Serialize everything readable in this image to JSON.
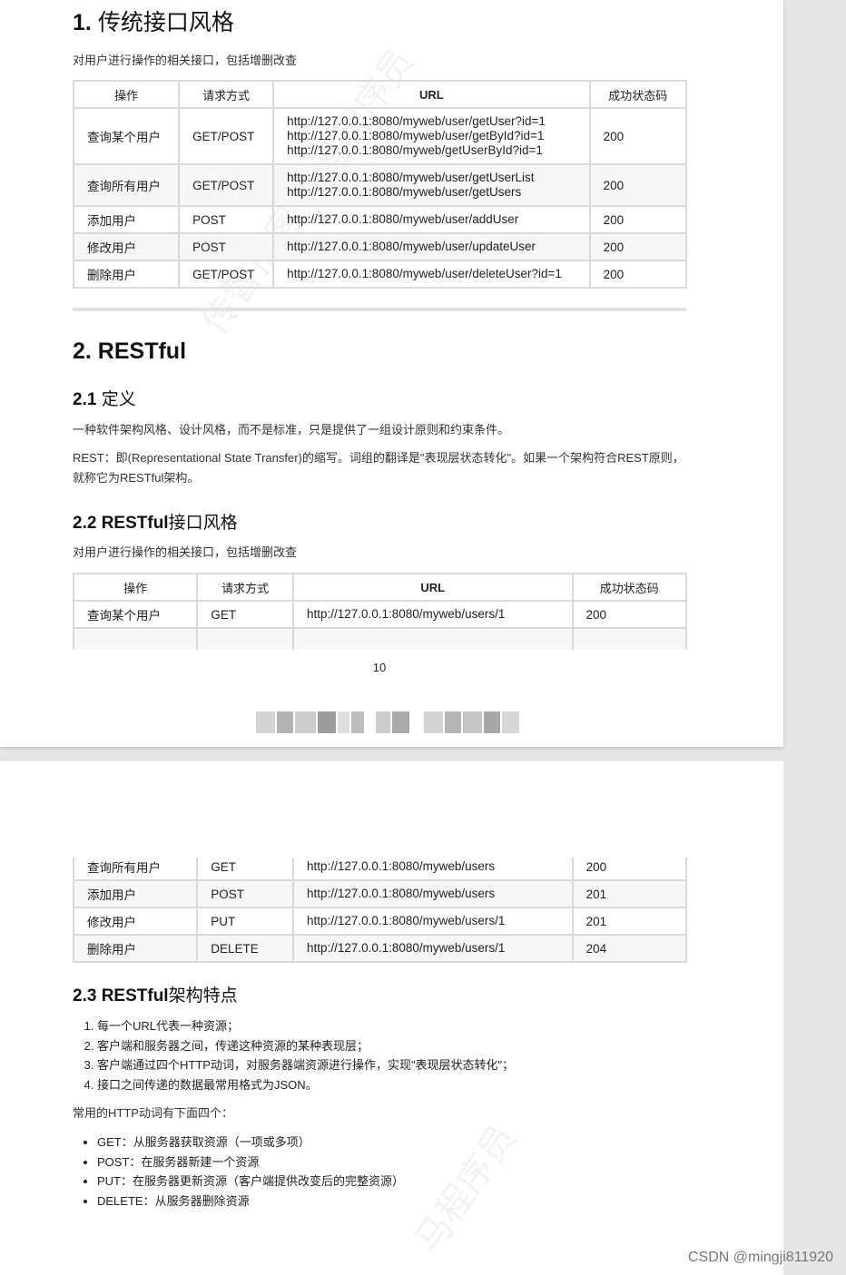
{
  "section1": {
    "title_num": "1.",
    "title_text": "传统接口风格",
    "intro": "对用户进行操作的相关接口，包括增删改查",
    "headers": [
      "操作",
      "请求方式",
      "URL",
      "成功状态码"
    ],
    "rows": [
      {
        "op": "查询某个用户",
        "method": "GET/POST",
        "urls": [
          "http://127.0.0.1:8080/myweb/user/getUser?id=1",
          "http://127.0.0.1:8080/myweb/user/getById?id=1",
          "http://127.0.0.1:8080/myweb/getUserById?id=1"
        ],
        "code": "200"
      },
      {
        "op": "查询所有用户",
        "method": "GET/POST",
        "urls": [
          "http://127.0.0.1:8080/myweb/user/getUserList",
          "http://127.0.0.1:8080/myweb/user/getUsers"
        ],
        "code": "200"
      },
      {
        "op": "添加用户",
        "method": "POST",
        "urls": [
          "http://127.0.0.1:8080/myweb/user/addUser"
        ],
        "code": "200"
      },
      {
        "op": "修改用户",
        "method": "POST",
        "urls": [
          "http://127.0.0.1:8080/myweb/user/updateUser"
        ],
        "code": "200"
      },
      {
        "op": "删除用户",
        "method": "GET/POST",
        "urls": [
          "http://127.0.0.1:8080/myweb/user/deleteUser?id=1"
        ],
        "code": "200"
      }
    ]
  },
  "section2": {
    "title": "2. RESTful",
    "sub1_num": "2.1",
    "sub1_text": "定义",
    "def1": "一种软件架构风格、设计风格，而不是标准，只是提供了一组设计原则和约束条件。",
    "def2": "REST：即(Representational State Transfer)的缩写。词组的翻译是\"表现层状态转化\"。如果一个架构符合REST原则，就称它为RESTful架构。",
    "sub2_num": "2.2 RESTful",
    "sub2_text": "接口风格",
    "intro": "对用户进行操作的相关接口，包括增删改查",
    "headers": [
      "操作",
      "请求方式",
      "URL",
      "成功状态码"
    ],
    "rows_page1": [
      {
        "op": "查询某个用户",
        "method": "GET",
        "url": "http://127.0.0.1:8080/myweb/users/1",
        "code": "200"
      }
    ],
    "rows_page2": [
      {
        "op": "查询所有用户",
        "method": "GET",
        "url": "http://127.0.0.1:8080/myweb/users",
        "code": "200"
      },
      {
        "op": "添加用户",
        "method": "POST",
        "url": "http://127.0.0.1:8080/myweb/users",
        "code": "201"
      },
      {
        "op": "修改用户",
        "method": "PUT",
        "url": "http://127.0.0.1:8080/myweb/users/1",
        "code": "201"
      },
      {
        "op": "删除用户",
        "method": "DELETE",
        "url": "http://127.0.0.1:8080/myweb/users/1",
        "code": "204"
      }
    ],
    "sub3_num": "2.3 RESTful",
    "sub3_text": "架构特点",
    "features": [
      "每一个URL代表一种资源；",
      "客户端和服务器之间，传递这种资源的某种表现层；",
      "客户端通过四个HTTP动词，对服务器端资源进行操作，实现\"表现层状态转化\"；",
      "接口之间传递的数据最常用格式为JSON。"
    ],
    "verbs_intro": "常用的HTTP动词有下面四个：",
    "verbs": [
      "GET：从服务器获取资源（一项或多项）",
      "POST：在服务器新建一个资源",
      "PUT：在服务器更新资源（客户端提供改变后的完整资源）",
      "DELETE：从服务器删除资源"
    ]
  },
  "page_number": "10",
  "watermark_text": "传智播客·黑马程序员",
  "watermark_text2": "马程序员",
  "csdn_credit": "CSDN @mingji811920"
}
